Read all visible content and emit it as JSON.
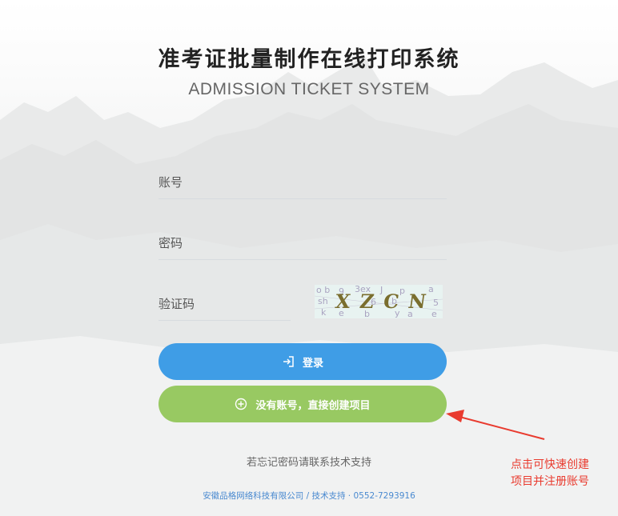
{
  "header": {
    "title": "准考证批量制作在线打印系统",
    "subtitle": "ADMISSION TICKET SYSTEM"
  },
  "form": {
    "account_placeholder": "账号",
    "password_placeholder": "密码",
    "captcha_placeholder": "验证码",
    "captcha_text": "XZCN"
  },
  "buttons": {
    "login_label": "登录",
    "create_label": "没有账号，直接创建项目"
  },
  "forgot_text": "若忘记密码请联系技术支持",
  "footer_text": "安徽品格网络科技有限公司 / 技术支持 · 0552-7293916",
  "annotation": {
    "line1": "点击可快速创建",
    "line2": "项目并注册账号"
  },
  "colors": {
    "login": "#3f9de6",
    "create": "#98c962",
    "annotation": "#e93b2f"
  }
}
